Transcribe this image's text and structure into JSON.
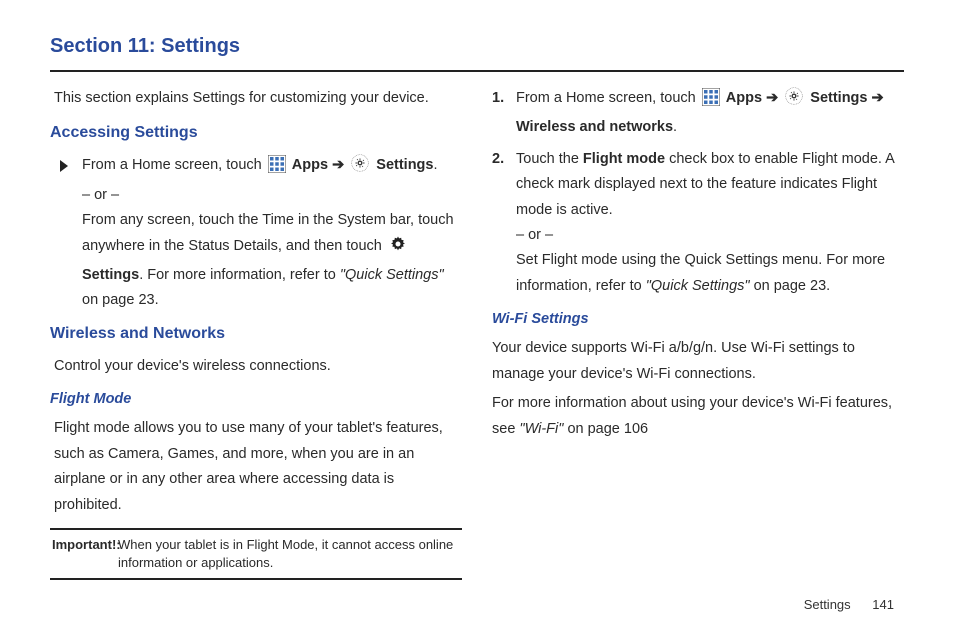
{
  "title": "Section 11: Settings",
  "intro": "This section explains Settings for customizing your device.",
  "h_accessing": "Accessing Settings",
  "bul1_a": "From a Home screen, touch ",
  "apps_label": "Apps",
  "arrow": " ➔ ",
  "settings_label": "Settings",
  "period": ".",
  "or": "– or –",
  "bul1_b1": "From any screen, touch the Time in the System bar, touch anywhere in the Status Details, and then touch ",
  "bul1_b2": ". For more information, refer to ",
  "quick_settings_ref": "\"Quick Settings\" ",
  "onpage23": " on page 23.",
  "h_wireless": "Wireless and Networks",
  "wireless_intro": "Control your device's wireless connections.",
  "h_flight": "Flight Mode",
  "flight_para": "Flight mode allows you to use many of your tablet's features, such as Camera, Games, and more, when you are in an airplane or in any other area where accessing data is prohibited.",
  "note_label": "Important!:",
  "note_body": "When your tablet is in Flight Mode, it cannot access online information or applications.",
  "step1_a": "From a Home screen, touch ",
  "wn_label": "Wireless and networks",
  "step2_a": "Touch the ",
  "flightmode_label": "Flight mode",
  "step2_b": " check box to enable Flight mode. A check mark displayed next to the feature indicates Flight mode is active.",
  "step2_c": "Set Flight mode using the Quick Settings menu. For more information, refer to ",
  "h_wifi": "Wi-Fi Settings",
  "wifi_p1": "Your device supports Wi-Fi a/b/g/n. Use Wi-Fi settings to manage your device's Wi-Fi connections.",
  "wifi_p2a": "For more information about using your device's Wi-Fi features, see ",
  "wifi_ref": "\"Wi-Fi\" ",
  "wifi_p2b": "on page 106",
  "footer_label": "Settings",
  "footer_page": "141",
  "num1": "1.",
  "num2": "2."
}
